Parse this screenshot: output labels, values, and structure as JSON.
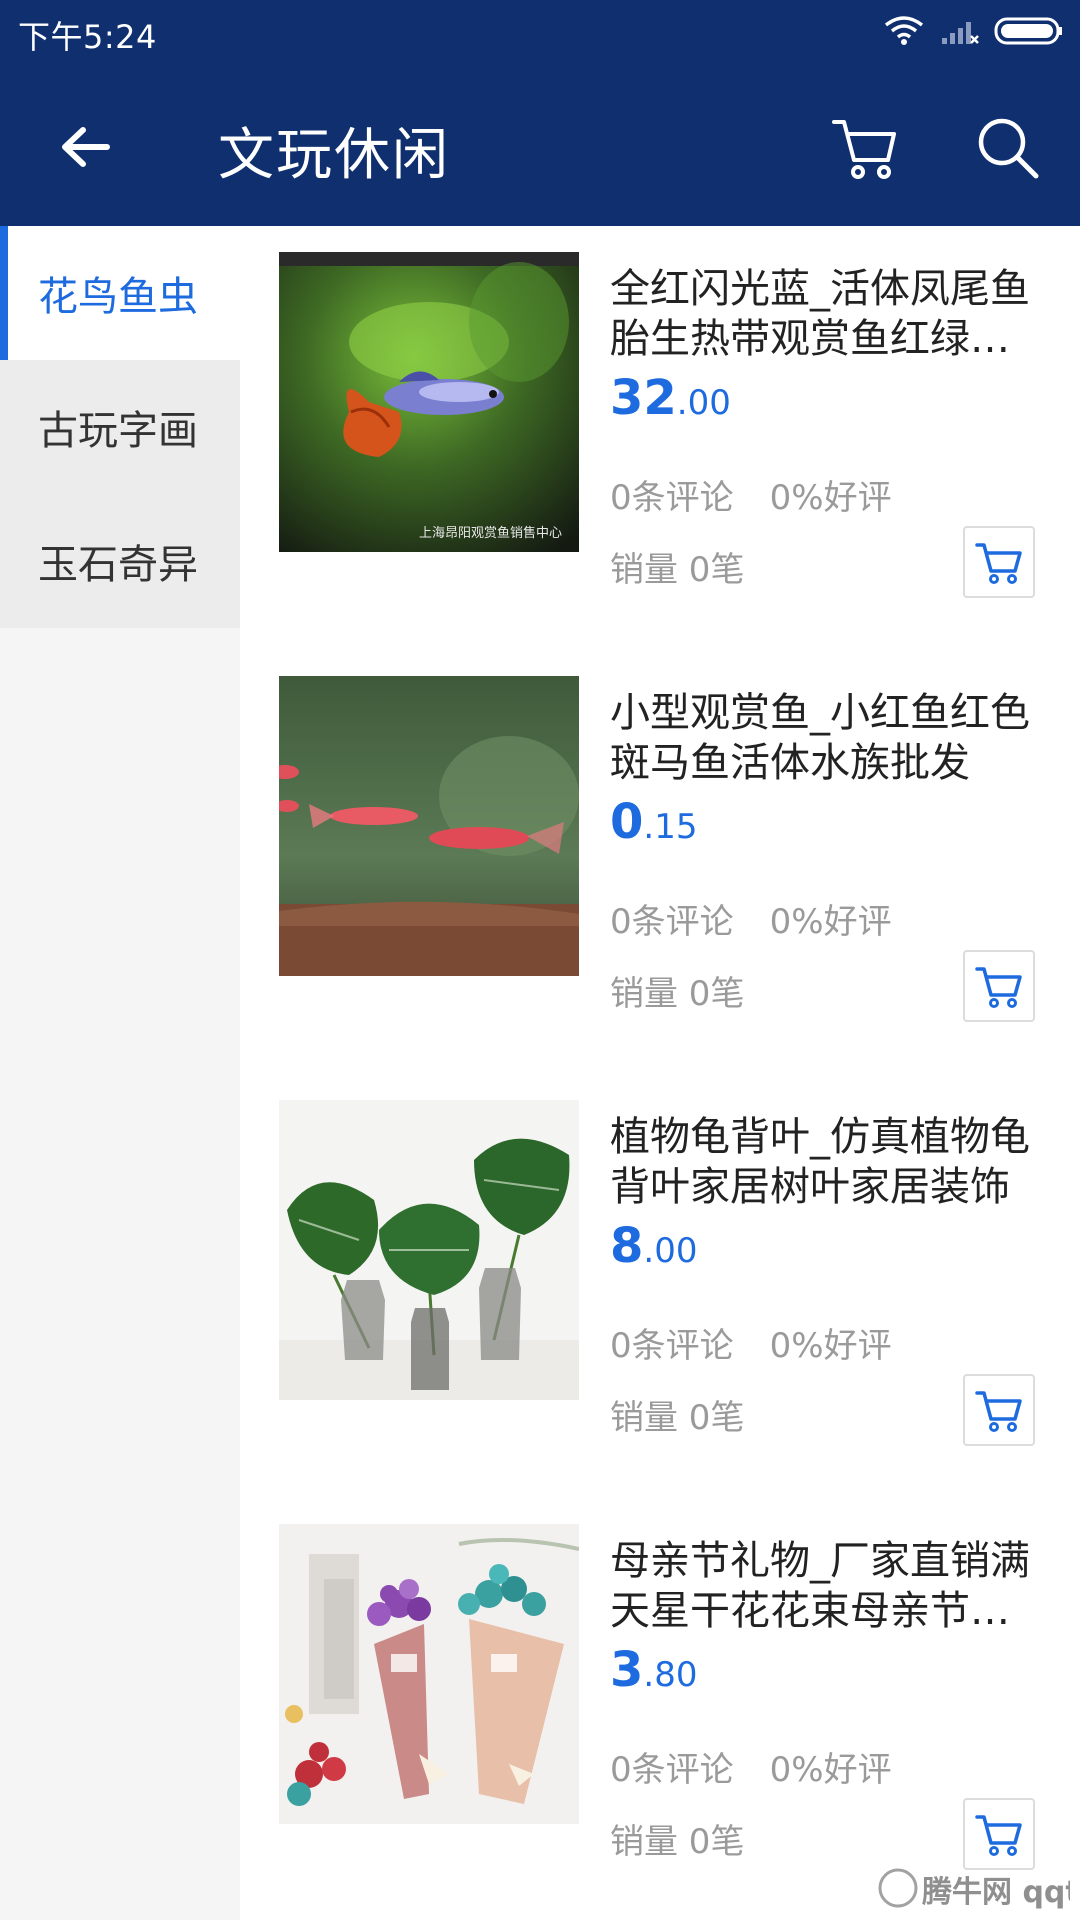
{
  "status_bar": {
    "time": "下午5:24"
  },
  "app_bar": {
    "title": "文玩休闲"
  },
  "sidebar": {
    "items": [
      {
        "label": "花鸟鱼虫",
        "active": true
      },
      {
        "label": "古玩字画",
        "active": false
      },
      {
        "label": "玉石奇异",
        "active": false
      }
    ]
  },
  "products": [
    {
      "name": "全红闪光蓝_活体凤尾鱼胎生热带观赏鱼红绿灯斗鱼",
      "price_int": "32",
      "price_dec": ".00",
      "reviews": "0条评论",
      "rating": "0%好评",
      "sales": "销量 0笔",
      "image": "guppy-fish-photo",
      "image_caption": "上海昂阳观赏鱼销售中心"
    },
    {
      "name": "小型观赏鱼_小红鱼红色斑马鱼活体水族批发",
      "price_int": "0",
      "price_dec": ".15",
      "reviews": "0条评论",
      "rating": "0%好评",
      "sales": "销量 0笔",
      "image": "red-zebra-fish-photo"
    },
    {
      "name": "植物龟背叶_仿真植物龟背叶家居树叶家居装饰",
      "price_int": "8",
      "price_dec": ".00",
      "reviews": "0条评论",
      "rating": "0%好评",
      "sales": "销量 0笔",
      "image": "monstera-leaves-vases-photo"
    },
    {
      "name": "母亲节礼物_厂家直销满天星干花花束母亲节礼物",
      "price_int": "3",
      "price_dec": ".80",
      "reviews": "0条评论",
      "rating": "0%好评",
      "sales": "销量 0笔",
      "image": "dried-flower-bouquets-photo"
    }
  ],
  "colors": {
    "header_bg": "#0f2f6e",
    "accent": "#1e6be0",
    "muted_text": "#9a9a9a"
  },
  "icons": {
    "back": "back-arrow-icon",
    "cart": "cart-icon",
    "search": "search-icon"
  },
  "watermark_text": "腾牛网 qqtn.com"
}
